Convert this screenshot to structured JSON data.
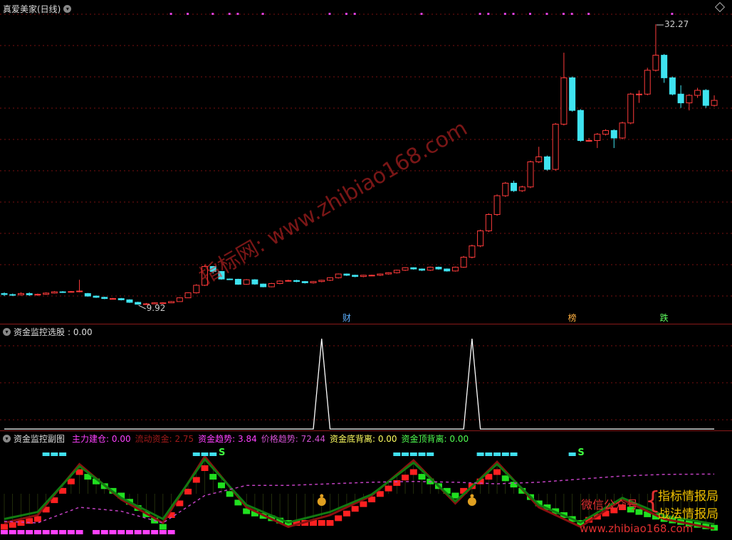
{
  "main_panel": {
    "title": "真爱美家(日线)",
    "high_label": "32.27",
    "low_label": "9.92",
    "markers": [
      "财",
      "榜",
      "跌"
    ],
    "colors": {
      "up": "#ff3b3b",
      "down": "#3fe3f0",
      "grid": "#7a1010"
    }
  },
  "select_panel": {
    "title": "资金监控选股",
    "value_text": ": 0.00"
  },
  "sub_panel": {
    "title": "资金监控副图",
    "indicators": [
      {
        "label": "主力建仓",
        "value": "0.00",
        "color": "#ff40ff"
      },
      {
        "label": "流动资金",
        "value": "2.75",
        "color": "#a01a1a"
      },
      {
        "label": "资金趋势",
        "value": "3.84",
        "color": "#ff40ff"
      },
      {
        "label": "价格趋势",
        "value": "72.44",
        "color": "#d050d0"
      },
      {
        "label": "资金底背离",
        "value": "0.00",
        "color": "#ffff60"
      },
      {
        "label": "资金顶背离",
        "value": "0.00",
        "color": "#50ff50"
      }
    ],
    "signal_s": "S"
  },
  "watermarks": {
    "diagonal": "指标网: www.zhibiao168.com",
    "wechat": "微信公众号",
    "line1": "指标情报局",
    "line2": "战法情报局",
    "url": "www.zhibiao168.com"
  },
  "chart_data": [
    {
      "type": "candlestick",
      "title": "真爱美家(日线)",
      "x": [
        1,
        2,
        3,
        4,
        5,
        6,
        7,
        8,
        9,
        10,
        11,
        12,
        13,
        14,
        15,
        16,
        17,
        18,
        19,
        20,
        21,
        22,
        23,
        24,
        25,
        26,
        27,
        28,
        29,
        30,
        31,
        32,
        33,
        34,
        35,
        36,
        37,
        38,
        39,
        40,
        41,
        42,
        43,
        44,
        45,
        46,
        47,
        48,
        49,
        50,
        51,
        52,
        53,
        54,
        55,
        56,
        57,
        58,
        59,
        60,
        61,
        62,
        63,
        64,
        65,
        66,
        67,
        68,
        69,
        70,
        71,
        72,
        73,
        74,
        75,
        76,
        77,
        78,
        79,
        80,
        81,
        82,
        83,
        84,
        85,
        86
      ],
      "open": [
        10.8,
        10.72,
        10.7,
        10.8,
        10.7,
        10.74,
        10.84,
        10.94,
        10.92,
        10.96,
        10.8,
        10.6,
        10.5,
        10.4,
        10.4,
        10.3,
        10.1,
        9.95,
        9.98,
        10.06,
        10.06,
        10.16,
        10.46,
        10.86,
        11.46,
        12.96,
        12.56,
        11.96,
        11.94,
        11.54,
        11.9,
        11.56,
        11.34,
        11.6,
        11.8,
        11.84,
        11.76,
        11.66,
        11.76,
        11.86,
        12.06,
        12.36,
        12.26,
        12.16,
        12.26,
        12.26,
        12.36,
        12.46,
        12.66,
        12.86,
        12.76,
        12.66,
        12.9,
        12.76,
        12.6,
        12.9,
        13.7,
        14.6,
        15.8,
        17.1,
        18.6,
        19.6,
        19.0,
        19.3,
        21.3,
        21.7,
        20.7,
        24.3,
        28.0,
        25.4,
        23.0,
        23.0,
        23.5,
        23.8,
        23.2,
        24.4,
        26.7,
        26.7,
        28.6,
        29.8,
        28.0,
        26.7,
        26.0,
        26.6,
        27.0,
        25.8
      ],
      "close": [
        10.72,
        10.7,
        10.8,
        10.7,
        10.74,
        10.84,
        10.94,
        10.92,
        10.96,
        11.0,
        10.6,
        10.5,
        10.4,
        10.4,
        10.3,
        10.1,
        9.95,
        9.98,
        10.06,
        10.06,
        10.16,
        10.46,
        10.86,
        11.46,
        12.96,
        12.56,
        11.96,
        11.94,
        11.54,
        11.9,
        11.56,
        11.34,
        11.6,
        11.8,
        11.84,
        11.76,
        11.66,
        11.76,
        11.86,
        12.06,
        12.36,
        12.26,
        12.16,
        12.26,
        12.26,
        12.36,
        12.46,
        12.66,
        12.86,
        12.76,
        12.66,
        12.9,
        12.76,
        12.6,
        12.9,
        13.7,
        14.6,
        15.8,
        17.1,
        18.6,
        19.6,
        19.0,
        19.3,
        21.3,
        21.7,
        20.7,
        24.3,
        28.0,
        25.4,
        23.0,
        23.0,
        23.5,
        23.8,
        23.2,
        24.4,
        26.7,
        26.7,
        28.6,
        29.8,
        28.0,
        26.7,
        26.0,
        26.6,
        27.0,
        25.8,
        26.2
      ],
      "high": [
        10.9,
        10.8,
        10.9,
        10.9,
        10.8,
        10.9,
        11.0,
        11.0,
        11.0,
        11.9,
        10.85,
        10.65,
        10.55,
        10.45,
        10.45,
        10.35,
        10.15,
        10.05,
        10.1,
        10.1,
        10.2,
        10.5,
        10.9,
        11.55,
        13.05,
        13.0,
        12.6,
        12.0,
        11.98,
        11.95,
        11.95,
        11.6,
        11.65,
        11.85,
        11.9,
        11.9,
        11.8,
        11.8,
        11.9,
        12.1,
        12.4,
        12.4,
        12.3,
        12.3,
        12.3,
        12.4,
        12.5,
        12.7,
        12.9,
        12.9,
        12.8,
        12.95,
        12.95,
        12.8,
        12.95,
        13.8,
        14.7,
        15.9,
        17.2,
        18.7,
        19.7,
        19.8,
        19.4,
        21.4,
        22.5,
        21.8,
        24.4,
        30.0,
        28.1,
        25.5,
        23.2,
        23.6,
        23.9,
        23.9,
        24.5,
        26.8,
        27.0,
        28.8,
        32.27,
        29.9,
        28.1,
        27.4,
        26.7,
        27.2,
        27.1,
        26.6
      ],
      "low": [
        10.6,
        10.6,
        10.65,
        10.6,
        10.62,
        10.7,
        10.8,
        10.85,
        10.9,
        10.9,
        10.55,
        10.45,
        10.35,
        10.35,
        10.25,
        10.05,
        9.92,
        9.93,
        10.0,
        10.0,
        10.1,
        10.4,
        10.8,
        10.8,
        11.4,
        12.4,
        11.9,
        11.9,
        11.5,
        11.5,
        11.5,
        11.3,
        11.3,
        11.55,
        11.75,
        11.7,
        11.6,
        11.6,
        11.7,
        11.8,
        12.0,
        12.2,
        12.1,
        12.1,
        12.2,
        12.2,
        12.3,
        12.4,
        12.6,
        12.7,
        12.6,
        12.6,
        12.7,
        12.55,
        12.55,
        12.85,
        13.6,
        14.5,
        15.7,
        17.0,
        18.5,
        18.9,
        18.9,
        19.2,
        21.2,
        20.6,
        20.6,
        24.2,
        25.3,
        22.9,
        22.9,
        22.4,
        23.4,
        22.4,
        23.1,
        24.3,
        26.0,
        26.6,
        28.5,
        27.6,
        26.6,
        25.6,
        25.4,
        26.4,
        25.6,
        25.7
      ]
    },
    {
      "type": "line",
      "title": "资金监控选股",
      "series": [
        {
          "name": "资金监控选股",
          "points": [
            [
              1,
              0
            ],
            [
              38,
              0
            ],
            [
              39,
              1
            ],
            [
              40,
              0
            ],
            [
              56,
              0
            ],
            [
              57,
              1
            ],
            [
              58,
              0
            ],
            [
              86,
              0
            ]
          ]
        }
      ]
    },
    {
      "type": "area",
      "title": "资金监控副图",
      "x": [
        1,
        5,
        10,
        15,
        20,
        25,
        30,
        35,
        40,
        45,
        50,
        55,
        60,
        65,
        70,
        75,
        80,
        86
      ],
      "series": [
        {
          "name": "主力建仓",
          "values": [
            0,
            0,
            0,
            0,
            0,
            0,
            0,
            0,
            0,
            0,
            0,
            0,
            0,
            0,
            0,
            0,
            0,
            0
          ]
        },
        {
          "name": "流动资金",
          "values": [
            10,
            20,
            85,
            40,
            10,
            95,
            30,
            5,
            20,
            45,
            90,
            35,
            88,
            30,
            5,
            40,
            15,
            2.75
          ]
        },
        {
          "name": "资金趋势",
          "values": [
            5,
            15,
            75,
            45,
            5,
            80,
            25,
            10,
            10,
            40,
            75,
            45,
            75,
            35,
            10,
            30,
            15,
            3.84
          ]
        },
        {
          "name": "价格趋势",
          "values": [
            12,
            10,
            30,
            25,
            10,
            45,
            58,
            58,
            60,
            62,
            63,
            62,
            60,
            62,
            66,
            70,
            72,
            72.44
          ]
        },
        {
          "name": "资金底背离",
          "values": [
            0,
            0,
            0,
            0,
            0,
            0,
            0,
            0,
            0,
            0,
            0,
            0,
            0,
            0,
            0,
            0,
            0,
            0
          ]
        },
        {
          "name": "资金顶背离",
          "values": [
            0,
            0,
            0,
            0,
            0,
            0,
            0,
            0,
            0,
            0,
            0,
            0,
            0,
            0,
            0,
            0,
            0,
            0
          ]
        }
      ]
    }
  ]
}
